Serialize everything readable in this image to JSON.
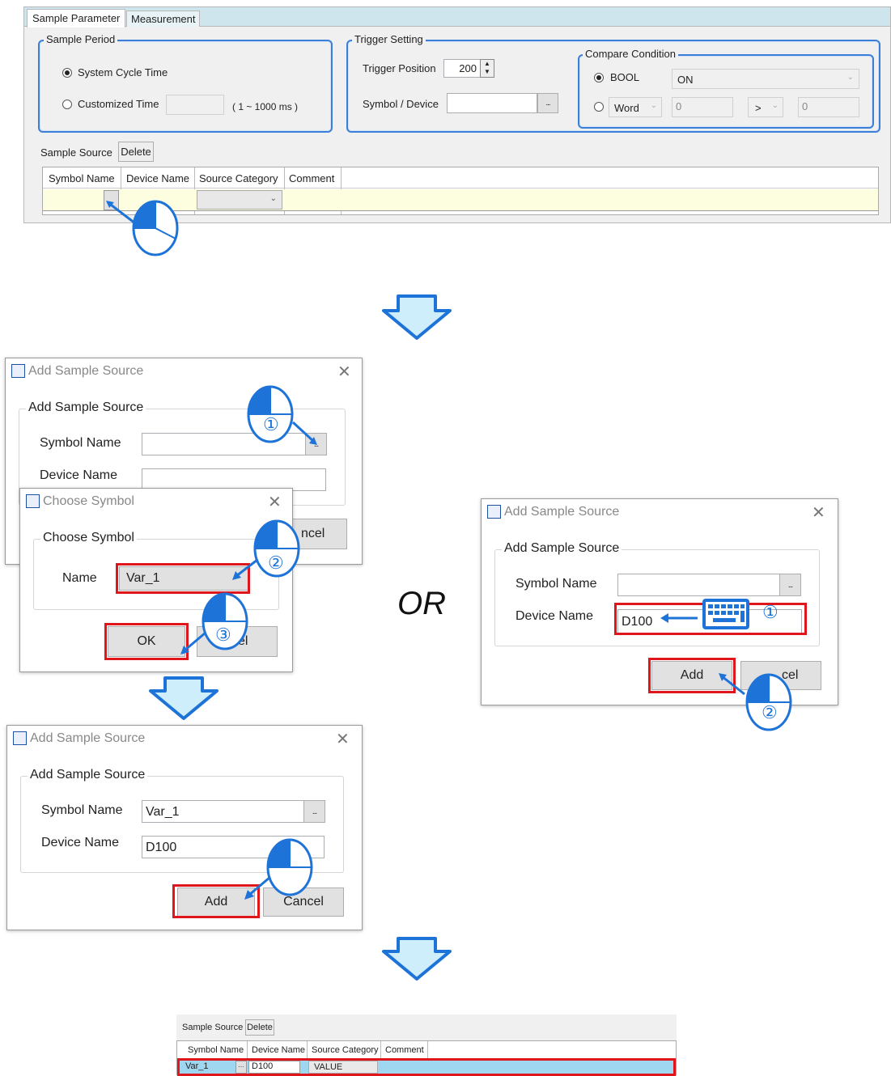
{
  "top_panel": {
    "tabs": [
      "Sample Parameter",
      "Measurement"
    ],
    "sample_period": {
      "legend": "Sample Period",
      "system_cycle": "System Cycle Time",
      "customized": "Customized Time",
      "range": "( 1 ~ 1000 ms )"
    },
    "trigger": {
      "legend": "Trigger Setting",
      "position_label": "Trigger Position",
      "position_value": "200",
      "symbol_label": "Symbol / Device",
      "browse": "..."
    },
    "compare": {
      "legend": "Compare Condition",
      "bool": "BOOL",
      "bool_value": "ON",
      "word": "Word",
      "word_value1": "0",
      "operator": ">",
      "word_value2": "0"
    },
    "sample_source_label": "Sample Source",
    "delete_label": "Delete",
    "columns": [
      "Symbol Name",
      "Device Name",
      "Source Category",
      "Comment"
    ]
  },
  "dialog_a": {
    "title": "Add Sample Source",
    "group": "Add Sample Source",
    "symbol_label": "Symbol Name",
    "device_label": "Device Name",
    "browse": "...",
    "cancel_partial": "ncel"
  },
  "choose_symbol": {
    "title": "Choose Symbol",
    "group": "Choose Symbol",
    "name_label": "Name",
    "name_value": "Var_1",
    "ok": "OK",
    "cancel_partial": "cel"
  },
  "or_text": "OR",
  "dialog_b": {
    "title": "Add Sample Source",
    "group": "Add Sample Source",
    "symbol_label": "Symbol Name",
    "device_label": "Device Name",
    "device_value": "D100",
    "browse": "...",
    "add": "Add",
    "cancel_partial": "cel"
  },
  "dialog_c": {
    "title": "Add Sample Source",
    "group": "Add Sample Source",
    "symbol_label": "Symbol Name",
    "symbol_value": "Var_1",
    "device_label": "Device Name",
    "device_value": "D100",
    "browse": "...",
    "add": "Add",
    "cancel": "Cancel"
  },
  "result_panel": {
    "sample_source_label": "Sample Source",
    "delete_label": "Delete",
    "columns": [
      "Symbol Name",
      "Device Name",
      "Source Category",
      "Comment"
    ],
    "row": {
      "symbol": "Var_1",
      "browse": "...",
      "device": "D100",
      "category": "VALUE"
    }
  },
  "step_marks": {
    "one": "①",
    "two": "②",
    "three": "③"
  },
  "colors": {
    "accent": "#1e73d8",
    "highlight": "#e0161d",
    "arrow_fill": "#cfeefb",
    "row_yellow": "#fdfde0"
  }
}
